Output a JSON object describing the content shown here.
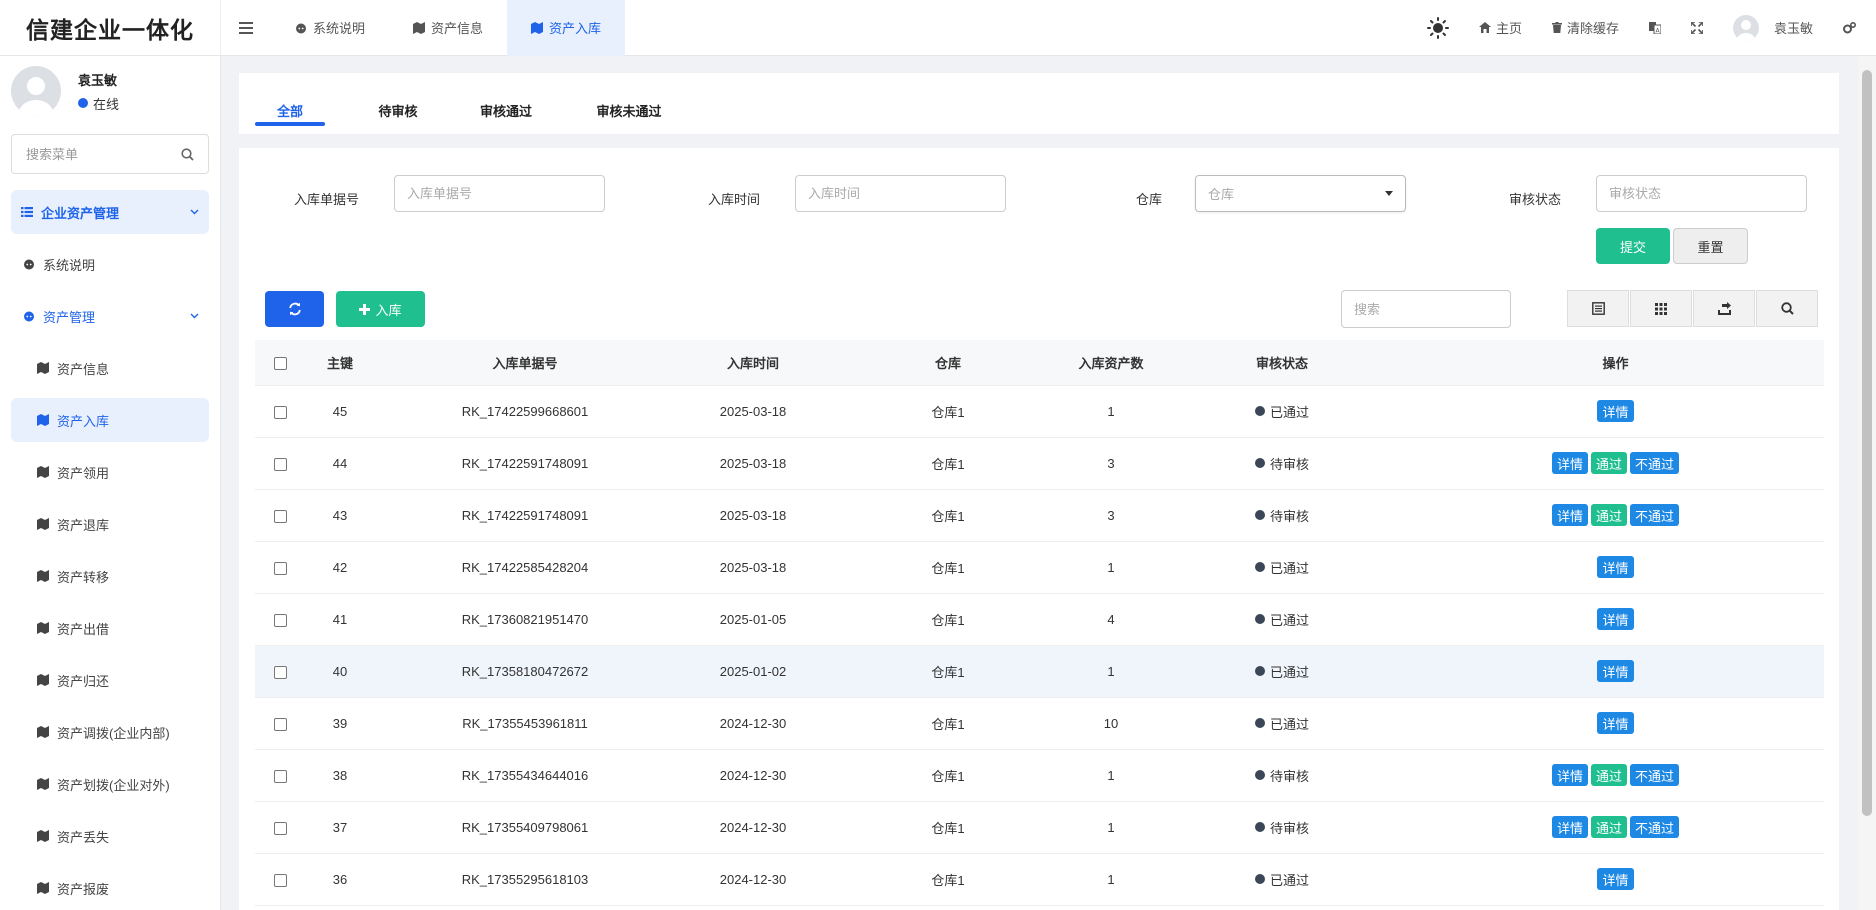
{
  "app": {
    "logo": "信建企业一体化"
  },
  "topbar": {
    "tabs": [
      {
        "label": "系统说明",
        "icon": "github-icon"
      },
      {
        "label": "资产信息",
        "icon": "map-icon"
      },
      {
        "label": "资产入库",
        "icon": "map-icon",
        "active": true
      }
    ],
    "right": {
      "home": "主页",
      "clear_cache": "清除缓存",
      "user": "袁玉敏"
    }
  },
  "sidebar": {
    "user": {
      "name": "袁玉敏",
      "status": "在线"
    },
    "search_placeholder": "搜索菜单",
    "group": "企业资产管理",
    "items": [
      {
        "label": "系统说明",
        "icon": "github-icon"
      }
    ],
    "sub_group": "资产管理",
    "sub_items": [
      {
        "label": "资产信息",
        "active": false
      },
      {
        "label": "资产入库",
        "active": true
      },
      {
        "label": "资产领用",
        "active": false
      },
      {
        "label": "资产退库",
        "active": false
      },
      {
        "label": "资产转移",
        "active": false
      },
      {
        "label": "资产出借",
        "active": false
      },
      {
        "label": "资产归还",
        "active": false
      },
      {
        "label": "资产调拨(企业内部)",
        "active": false
      },
      {
        "label": "资产划拨(企业对外)",
        "active": false
      },
      {
        "label": "资产丢失",
        "active": false
      },
      {
        "label": "资产报废",
        "active": false
      }
    ]
  },
  "status_tabs": [
    "全部",
    "待审核",
    "审核通过",
    "审核未通过"
  ],
  "filters": {
    "doc_no": {
      "label": "入库单据号",
      "placeholder": "入库单据号"
    },
    "date": {
      "label": "入库时间",
      "placeholder": "入库时间"
    },
    "warehouse": {
      "label": "仓库",
      "placeholder": "仓库"
    },
    "status": {
      "label": "审核状态",
      "placeholder": "审核状态"
    },
    "submit": "提交",
    "reset": "重置"
  },
  "toolbar": {
    "add": "入库",
    "search_placeholder": "搜索"
  },
  "table": {
    "headers": [
      "主键",
      "入库单据号",
      "入库时间",
      "仓库",
      "入库资产数",
      "审核状态",
      "操作"
    ],
    "ops": {
      "detail": "详情",
      "pass": "通过",
      "fail": "不通过"
    },
    "rows": [
      {
        "id": "45",
        "doc": "RK_17422599668601",
        "date": "2025-03-18",
        "wh": "仓库1",
        "count": "1",
        "status": "已通过",
        "pending": false
      },
      {
        "id": "44",
        "doc": "RK_17422591748091",
        "date": "2025-03-18",
        "wh": "仓库1",
        "count": "3",
        "status": "待审核",
        "pending": true
      },
      {
        "id": "43",
        "doc": "RK_17422591748091",
        "date": "2025-03-18",
        "wh": "仓库1",
        "count": "3",
        "status": "待审核",
        "pending": true
      },
      {
        "id": "42",
        "doc": "RK_17422585428204",
        "date": "2025-03-18",
        "wh": "仓库1",
        "count": "1",
        "status": "已通过",
        "pending": false
      },
      {
        "id": "41",
        "doc": "RK_17360821951470",
        "date": "2025-01-05",
        "wh": "仓库1",
        "count": "4",
        "status": "已通过",
        "pending": false
      },
      {
        "id": "40",
        "doc": "RK_17358180472672",
        "date": "2025-01-02",
        "wh": "仓库1",
        "count": "1",
        "status": "已通过",
        "pending": false,
        "highlight": true
      },
      {
        "id": "39",
        "doc": "RK_17355453961811",
        "date": "2024-12-30",
        "wh": "仓库1",
        "count": "10",
        "status": "已通过",
        "pending": false
      },
      {
        "id": "38",
        "doc": "RK_17355434644016",
        "date": "2024-12-30",
        "wh": "仓库1",
        "count": "1",
        "status": "待审核",
        "pending": true
      },
      {
        "id": "37",
        "doc": "RK_17355409798061",
        "date": "2024-12-30",
        "wh": "仓库1",
        "count": "1",
        "status": "待审核",
        "pending": true
      },
      {
        "id": "36",
        "doc": "RK_17355295618103",
        "date": "2024-12-30",
        "wh": "仓库1",
        "count": "1",
        "status": "已通过",
        "pending": false
      }
    ]
  },
  "colors": {
    "primary": "#1e63e9",
    "success": "#1fbf8f",
    "info": "#1e88e5"
  }
}
